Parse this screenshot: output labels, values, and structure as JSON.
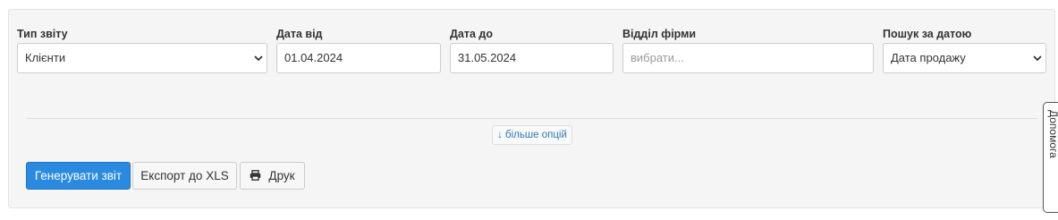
{
  "filters": {
    "report_type": {
      "label": "Тип звіту",
      "value": "Клієнти"
    },
    "date_from": {
      "label": "Дата від",
      "value": "01.04.2024"
    },
    "date_to": {
      "label": "Дата до",
      "value": "31.05.2024"
    },
    "department": {
      "label": "Відділ фірми",
      "placeholder": "вибрати..."
    },
    "search_by_date": {
      "label": "Пошук за датою",
      "value": "Дата продажу"
    }
  },
  "more_options_label": "↓ більше опцій",
  "actions": {
    "generate_label": "Генерувати звіт",
    "export_label": "Експорт до XLS",
    "print_label": "Друк"
  },
  "help_tab_label": "Допомога",
  "colors": {
    "primary": "#2a8ae0",
    "panel_bg": "#f5f5f5",
    "link": "#337ab7"
  },
  "icons": {
    "select_chevron": "chevron-down-icon",
    "print": "printer-icon"
  }
}
